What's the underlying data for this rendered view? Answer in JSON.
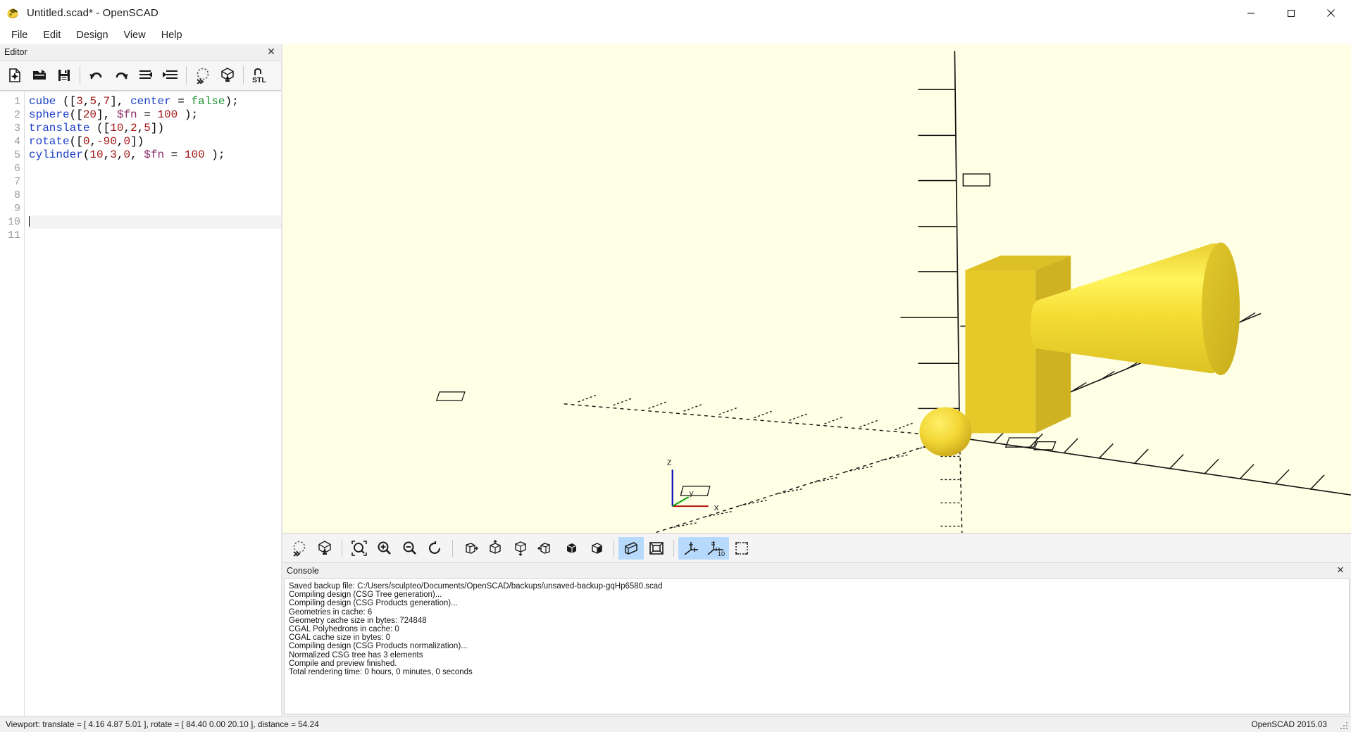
{
  "window": {
    "title": "Untitled.scad* - OpenSCAD",
    "app_icon": "openscad-logo-icon",
    "minimize_label": "—",
    "maximize_label": "□",
    "close_label": "✕"
  },
  "menubar": {
    "items": [
      {
        "label": "File"
      },
      {
        "label": "Edit"
      },
      {
        "label": "Design"
      },
      {
        "label": "View"
      },
      {
        "label": "Help"
      }
    ]
  },
  "editor_dock": {
    "title": "Editor",
    "close_label": "✕",
    "toolbar": [
      {
        "name": "new-file-button",
        "tooltip": "New"
      },
      {
        "name": "open-file-button",
        "tooltip": "Open"
      },
      {
        "name": "save-file-button",
        "tooltip": "Save"
      },
      {
        "name": "undo-button",
        "tooltip": "Undo"
      },
      {
        "name": "redo-button",
        "tooltip": "Redo"
      },
      {
        "name": "unindent-button",
        "tooltip": "Unindent"
      },
      {
        "name": "indent-button",
        "tooltip": "Indent"
      },
      {
        "name": "preview-button",
        "tooltip": "Preview"
      },
      {
        "name": "render-button",
        "tooltip": "Render"
      },
      {
        "name": "export-stl-button",
        "tooltip": "Export as STL"
      }
    ],
    "line_numbers": [
      "1",
      "2",
      "3",
      "4",
      "5",
      "6",
      "7",
      "8",
      "9",
      "10",
      "11"
    ],
    "cursor_line": 10,
    "code_lines": [
      {
        "n": 1,
        "tokens": [
          {
            "t": "cube",
            "c": "kw"
          },
          {
            "t": " (",
            "c": "punct"
          },
          {
            "t": "[",
            "c": "punct"
          },
          {
            "t": "3",
            "c": "num"
          },
          {
            "t": ",",
            "c": "punct"
          },
          {
            "t": "5",
            "c": "num"
          },
          {
            "t": ",",
            "c": "punct"
          },
          {
            "t": "7",
            "c": "num"
          },
          {
            "t": "]",
            "c": "punct"
          },
          {
            "t": ", ",
            "c": "punct"
          },
          {
            "t": "center",
            "c": "kw"
          },
          {
            "t": " = ",
            "c": "punct"
          },
          {
            "t": "false",
            "c": "bool"
          },
          {
            "t": ")",
            "c": "punct"
          },
          {
            "t": ";",
            "c": "punct"
          }
        ]
      },
      {
        "n": 2,
        "tokens": [
          {
            "t": "sphere",
            "c": "kw"
          },
          {
            "t": "(",
            "c": "punct"
          },
          {
            "t": "[",
            "c": "punct"
          },
          {
            "t": "20",
            "c": "num"
          },
          {
            "t": "]",
            "c": "punct"
          },
          {
            "t": ", ",
            "c": "punct"
          },
          {
            "t": "$fn",
            "c": "var"
          },
          {
            "t": " = ",
            "c": "punct"
          },
          {
            "t": "100",
            "c": "num"
          },
          {
            "t": " )",
            "c": "punct"
          },
          {
            "t": ";",
            "c": "punct"
          }
        ]
      },
      {
        "n": 3,
        "tokens": [
          {
            "t": "translate",
            "c": "kw"
          },
          {
            "t": " (",
            "c": "punct"
          },
          {
            "t": "[",
            "c": "punct"
          },
          {
            "t": "10",
            "c": "num"
          },
          {
            "t": ",",
            "c": "punct"
          },
          {
            "t": "2",
            "c": "num"
          },
          {
            "t": ",",
            "c": "punct"
          },
          {
            "t": "5",
            "c": "num"
          },
          {
            "t": "]",
            "c": "punct"
          },
          {
            "t": ")",
            "c": "punct"
          }
        ]
      },
      {
        "n": 4,
        "tokens": [
          {
            "t": "rotate",
            "c": "kw"
          },
          {
            "t": "(",
            "c": "punct"
          },
          {
            "t": "[",
            "c": "punct"
          },
          {
            "t": "0",
            "c": "num"
          },
          {
            "t": ",",
            "c": "punct"
          },
          {
            "t": "-90",
            "c": "num"
          },
          {
            "t": ",",
            "c": "punct"
          },
          {
            "t": "0",
            "c": "num"
          },
          {
            "t": "]",
            "c": "punct"
          },
          {
            "t": ")",
            "c": "punct"
          }
        ]
      },
      {
        "n": 5,
        "tokens": [
          {
            "t": "cylinder",
            "c": "kw"
          },
          {
            "t": "(",
            "c": "punct"
          },
          {
            "t": "10",
            "c": "num"
          },
          {
            "t": ",",
            "c": "punct"
          },
          {
            "t": "3",
            "c": "num"
          },
          {
            "t": ",",
            "c": "punct"
          },
          {
            "t": "0",
            "c": "num"
          },
          {
            "t": ", ",
            "c": "punct"
          },
          {
            "t": "$fn",
            "c": "var"
          },
          {
            "t": " = ",
            "c": "punct"
          },
          {
            "t": "100",
            "c": "num"
          },
          {
            "t": " )",
            "c": "punct"
          },
          {
            "t": ";",
            "c": "punct"
          }
        ]
      },
      {
        "n": 6,
        "tokens": []
      },
      {
        "n": 7,
        "tokens": []
      },
      {
        "n": 8,
        "tokens": []
      },
      {
        "n": 9,
        "tokens": []
      },
      {
        "n": 10,
        "tokens": []
      },
      {
        "n": 11,
        "tokens": []
      }
    ]
  },
  "viewport": {
    "background_color": "#ffffe5",
    "object_color": "#f9dd3c",
    "object_shade_color": "#d4b728",
    "axis_gizmo": {
      "x_label": "x",
      "y_label": "y",
      "z_label": "z",
      "x_color": "#b00000",
      "y_color": "#00a000",
      "z_color": "#0000c0"
    },
    "toolbar": [
      {
        "name": "preview-button",
        "tooltip": "Preview",
        "active": false
      },
      {
        "name": "render-button",
        "tooltip": "Render",
        "active": false
      },
      {
        "name": "zoom-all-button",
        "tooltip": "View All",
        "active": false
      },
      {
        "name": "zoom-in-button",
        "tooltip": "Zoom In",
        "active": false
      },
      {
        "name": "zoom-out-button",
        "tooltip": "Zoom Out",
        "active": false
      },
      {
        "name": "reset-view-button",
        "tooltip": "Reset View",
        "active": false
      },
      {
        "name": "view-right-button",
        "tooltip": "Right View",
        "active": false
      },
      {
        "name": "view-top-button",
        "tooltip": "Top View",
        "active": false
      },
      {
        "name": "view-bottom-button",
        "tooltip": "Bottom View",
        "active": false
      },
      {
        "name": "view-left-button",
        "tooltip": "Left View",
        "active": false
      },
      {
        "name": "view-front-button",
        "tooltip": "Front View",
        "active": false
      },
      {
        "name": "view-back-button",
        "tooltip": "Back View",
        "active": false
      },
      {
        "name": "perspective-button",
        "tooltip": "Perspective",
        "active": true
      },
      {
        "name": "orthogonal-button",
        "tooltip": "Orthogonal",
        "active": false
      },
      {
        "name": "show-axes-button",
        "tooltip": "Show Axes",
        "active": true
      },
      {
        "name": "show-scale-markers-button",
        "tooltip": "Show Scale Markers",
        "active": true,
        "label": "10"
      },
      {
        "name": "show-crosshairs-button",
        "tooltip": "Show Crosshairs",
        "active": false
      }
    ]
  },
  "console": {
    "title": "Console",
    "close_label": "✕",
    "lines": [
      "Saved backup file: C:/Users/sculpteo/Documents/OpenSCAD/backups/unsaved-backup-gqHp6580.scad",
      "Compiling design (CSG Tree generation)...",
      "Compiling design (CSG Products generation)...",
      "Geometries in cache: 6",
      "Geometry cache size in bytes: 724848",
      "CGAL Polyhedrons in cache: 0",
      "CGAL cache size in bytes: 0",
      "Compiling design (CSG Products normalization)...",
      "Normalized CSG tree has 3 elements",
      "Compile and preview finished.",
      "Total rendering time: 0 hours, 0 minutes, 0 seconds"
    ]
  },
  "statusbar": {
    "viewport_info": "Viewport: translate = [ 4.16 4.87 5.01 ], rotate = [ 84.40 0.00 20.10 ], distance = 54.24",
    "version": "OpenSCAD 2015.03"
  }
}
